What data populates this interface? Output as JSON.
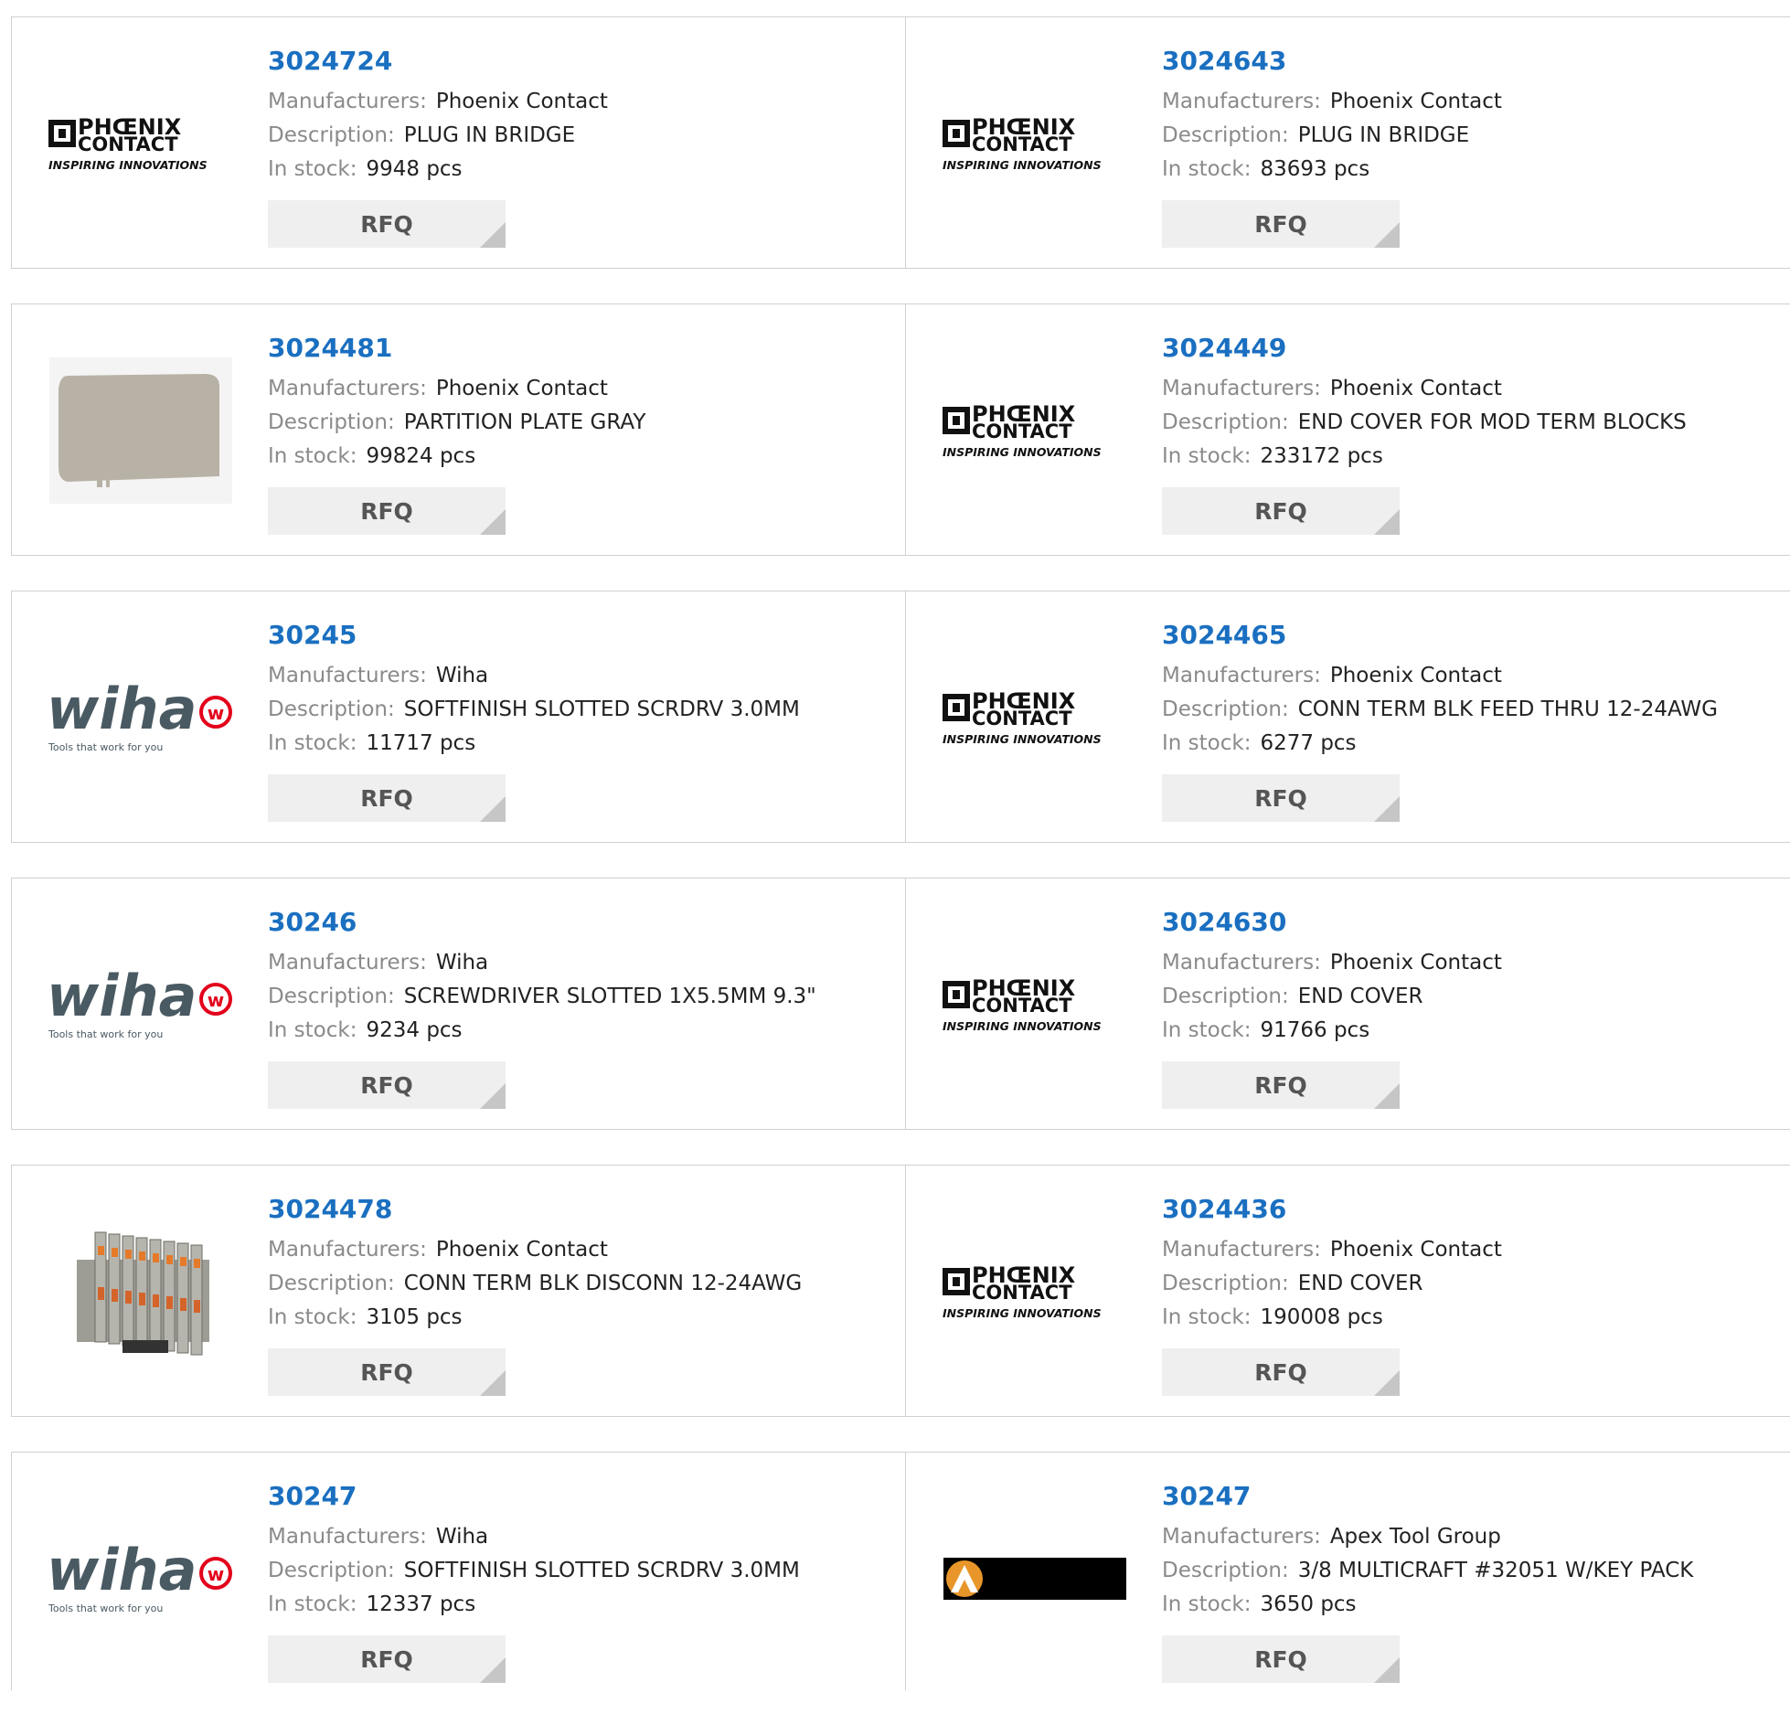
{
  "labels": {
    "manufacturers": "Manufacturers:",
    "description": "Description:",
    "in_stock": "In stock:",
    "rfq": "RFQ"
  },
  "brand_logos": {
    "phoenix_line1": "PHŒNIX",
    "phoenix_line2": "CONTACT",
    "phoenix_tagline": "INSPIRING INNOVATIONS",
    "wiha_name": "wiha",
    "wiha_tagline": "Tools that work for you"
  },
  "products": [
    {
      "part": "3024724",
      "manufacturer": "Phoenix Contact",
      "description": "PLUG IN BRIDGE",
      "stock": "9948 pcs",
      "image": "phoenix-contact-logo"
    },
    {
      "part": "3024643",
      "manufacturer": "Phoenix Contact",
      "description": "PLUG IN BRIDGE",
      "stock": "83693 pcs",
      "image": "phoenix-contact-logo"
    },
    {
      "part": "3024481",
      "manufacturer": "Phoenix Contact",
      "description": "PARTITION PLATE GRAY",
      "stock": "99824 pcs",
      "image": "partition-plate-photo"
    },
    {
      "part": "3024449",
      "manufacturer": "Phoenix Contact",
      "description": "END COVER FOR MOD TERM BLOCKS",
      "stock": "233172 pcs",
      "image": "phoenix-contact-logo"
    },
    {
      "part": "30245",
      "manufacturer": "Wiha",
      "description": "SOFTFINISH SLOTTED SCRDRV 3.0MM",
      "stock": "11717 pcs",
      "image": "wiha-logo"
    },
    {
      "part": "3024465",
      "manufacturer": "Phoenix Contact",
      "description": "CONN TERM BLK FEED THRU 12-24AWG",
      "stock": "6277 pcs",
      "image": "phoenix-contact-logo"
    },
    {
      "part": "30246",
      "manufacturer": "Wiha",
      "description": "SCREWDRIVER SLOTTED 1X5.5MM 9.3\"",
      "stock": "9234 pcs",
      "image": "wiha-logo"
    },
    {
      "part": "3024630",
      "manufacturer": "Phoenix Contact",
      "description": "END COVER",
      "stock": "91766 pcs",
      "image": "phoenix-contact-logo"
    },
    {
      "part": "3024478",
      "manufacturer": "Phoenix Contact",
      "description": "CONN TERM BLK DISCONN 12-24AWG",
      "stock": "3105 pcs",
      "image": "terminal-block-photo"
    },
    {
      "part": "3024436",
      "manufacturer": "Phoenix Contact",
      "description": "END COVER",
      "stock": "190008 pcs",
      "image": "phoenix-contact-logo"
    },
    {
      "part": "30247",
      "manufacturer": "Wiha",
      "description": "SOFTFINISH SLOTTED SCRDRV 3.0MM",
      "stock": "12337 pcs",
      "image": "wiha-logo"
    },
    {
      "part": "30247",
      "manufacturer": "Apex Tool Group",
      "description": "3/8 MULTICRAFT #32051 W/KEY PACK",
      "stock": "3650 pcs",
      "image": "apex-tool-group-logo"
    }
  ],
  "colors": {
    "part_link": "#1a6fc0",
    "label_gray": "#8a8a8a",
    "border": "#d0d0d0",
    "rfq_bg": "#efefef",
    "wiha_red": "#e3001b",
    "wiha_gray": "#4a5a63"
  }
}
